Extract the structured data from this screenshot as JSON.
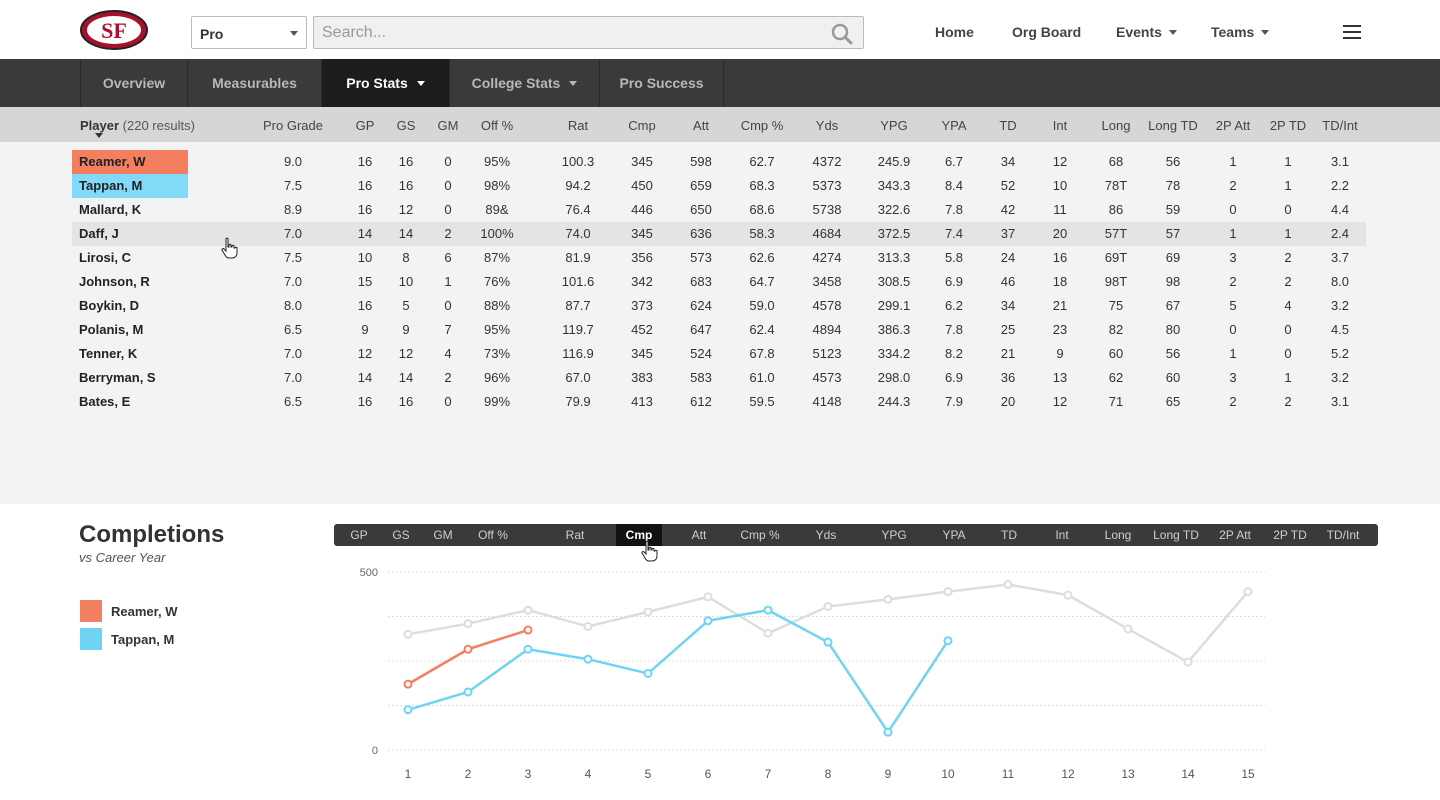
{
  "header": {
    "logo_text": "SF",
    "select_value": "Pro",
    "search_placeholder": "Search...",
    "nav": [
      {
        "label": "Home",
        "has_caret": false
      },
      {
        "label": "Org Board",
        "has_caret": false
      },
      {
        "label": "Events",
        "has_caret": true
      },
      {
        "label": "Teams",
        "has_caret": true
      }
    ]
  },
  "tabs": [
    {
      "label": "Overview",
      "active": false,
      "has_caret": false
    },
    {
      "label": "Measurables",
      "active": false,
      "has_caret": false
    },
    {
      "label": "Pro Stats",
      "active": true,
      "has_caret": true
    },
    {
      "label": "College Stats",
      "active": false,
      "has_caret": true
    },
    {
      "label": "Pro Success",
      "active": false,
      "has_caret": false
    }
  ],
  "table": {
    "player_header": "Player",
    "result_count": "(220 results)",
    "columns": [
      "Pro Grade",
      "GP",
      "GS",
      "GM",
      "Off %",
      "Rat",
      "Cmp",
      "Att",
      "Cmp %",
      "Yds",
      "YPG",
      "YPA",
      "TD",
      "Int",
      "Long",
      "Long TD",
      "2P Att",
      "2P TD",
      "TD/Int"
    ],
    "rows": [
      {
        "name": "Reamer, W",
        "highlight": "#f47f60",
        "cells": [
          "9.0",
          "16",
          "16",
          "0",
          "95%",
          "100.3",
          "345",
          "598",
          "62.7",
          "4372",
          "245.9",
          "6.7",
          "34",
          "12",
          "68",
          "56",
          "1",
          "1",
          "3.1"
        ]
      },
      {
        "name": "Tappan, M",
        "highlight": "#80daf8",
        "cells": [
          "7.5",
          "16",
          "16",
          "0",
          "98%",
          "94.2",
          "450",
          "659",
          "68.3",
          "5373",
          "343.3",
          "8.4",
          "52",
          "10",
          "78T",
          "78",
          "2",
          "1",
          "2.2"
        ]
      },
      {
        "name": "Mallard, K",
        "highlight": "",
        "cells": [
          "8.9",
          "16",
          "12",
          "0",
          "89&",
          "76.4",
          "446",
          "650",
          "68.6",
          "5738",
          "322.6",
          "7.8",
          "42",
          "11",
          "86",
          "59",
          "0",
          "0",
          "4.4"
        ]
      },
      {
        "name": "Daff, J",
        "highlight": "",
        "cells": [
          "7.0",
          "14",
          "14",
          "2",
          "100%",
          "74.0",
          "345",
          "636",
          "58.3",
          "4684",
          "372.5",
          "7.4",
          "37",
          "20",
          "57T",
          "57",
          "1",
          "1",
          "2.4"
        ]
      },
      {
        "name": "Lirosi, C",
        "highlight": "",
        "cells": [
          "7.5",
          "10",
          "8",
          "6",
          "87%",
          "81.9",
          "356",
          "573",
          "62.6",
          "4274",
          "313.3",
          "5.8",
          "24",
          "16",
          "69T",
          "69",
          "3",
          "2",
          "3.7"
        ]
      },
      {
        "name": "Johnson, R",
        "highlight": "",
        "cells": [
          "7.0",
          "15",
          "10",
          "1",
          "76%",
          "101.6",
          "342",
          "683",
          "64.7",
          "3458",
          "308.5",
          "6.9",
          "46",
          "18",
          "98T",
          "98",
          "2",
          "2",
          "8.0"
        ]
      },
      {
        "name": "Boykin, D",
        "highlight": "",
        "cells": [
          "8.0",
          "16",
          "5",
          "0",
          "88%",
          "87.7",
          "373",
          "624",
          "59.0",
          "4578",
          "299.1",
          "6.2",
          "34",
          "21",
          "75",
          "67",
          "5",
          "4",
          "3.2"
        ]
      },
      {
        "name": "Polanis, M",
        "highlight": "",
        "cells": [
          "6.5",
          "9",
          "9",
          "7",
          "95%",
          "119.7",
          "452",
          "647",
          "62.4",
          "4894",
          "386.3",
          "7.8",
          "25",
          "23",
          "82",
          "80",
          "0",
          "0",
          "4.5"
        ]
      },
      {
        "name": "Tenner, K",
        "highlight": "",
        "cells": [
          "7.0",
          "12",
          "12",
          "4",
          "73%",
          "116.9",
          "345",
          "524",
          "67.8",
          "5123",
          "334.2",
          "8.2",
          "21",
          "9",
          "60",
          "56",
          "1",
          "0",
          "5.2"
        ]
      },
      {
        "name": "Berryman, S",
        "highlight": "",
        "cells": [
          "7.0",
          "14",
          "14",
          "2",
          "96%",
          "67.0",
          "383",
          "583",
          "61.0",
          "4573",
          "298.0",
          "6.9",
          "36",
          "13",
          "62",
          "60",
          "3",
          "1",
          "3.2"
        ]
      },
      {
        "name": "Bates, E",
        "highlight": "",
        "cells": [
          "6.5",
          "16",
          "16",
          "0",
          "99%",
          "79.9",
          "413",
          "612",
          "59.5",
          "4148",
          "244.3",
          "7.9",
          "20",
          "12",
          "71",
          "65",
          "2",
          "2",
          "3.1"
        ]
      }
    ]
  },
  "chart_panel": {
    "title": "Completions",
    "subtitle": "vs Career Year",
    "stat_tabs": [
      "GP",
      "GS",
      "GM",
      "Off %",
      "Rat",
      "Cmp",
      "Att",
      "Cmp %",
      "Yds",
      "YPG",
      "YPA",
      "TD",
      "Int",
      "Long",
      "Long TD",
      "2P Att",
      "2P TD",
      "TD/Int"
    ],
    "active_stat": "Cmp"
  },
  "chart_data": {
    "type": "line",
    "x": [
      1,
      2,
      3,
      4,
      5,
      6,
      7,
      8,
      9,
      10,
      11,
      12,
      13,
      14,
      15
    ],
    "ylim": [
      0,
      500
    ],
    "yticks": [
      0,
      500
    ],
    "grid": true,
    "series": [
      {
        "name": "",
        "color": "#dddddd",
        "values": [
          325,
          355,
          393,
          347,
          388,
          430,
          328,
          403,
          423,
          445,
          465,
          435,
          340,
          247,
          445
        ]
      },
      {
        "name": "Reamer, W",
        "color": "#f47f60",
        "values": [
          185,
          283,
          337,
          null,
          null,
          null,
          null,
          null,
          null,
          null,
          null,
          null,
          null,
          null,
          null
        ]
      },
      {
        "name": "Tappan, M",
        "color": "#6fd4f4",
        "values": [
          113,
          163,
          283,
          255,
          215,
          363,
          393,
          303,
          50,
          307,
          null,
          null,
          null,
          null,
          null
        ]
      }
    ]
  }
}
